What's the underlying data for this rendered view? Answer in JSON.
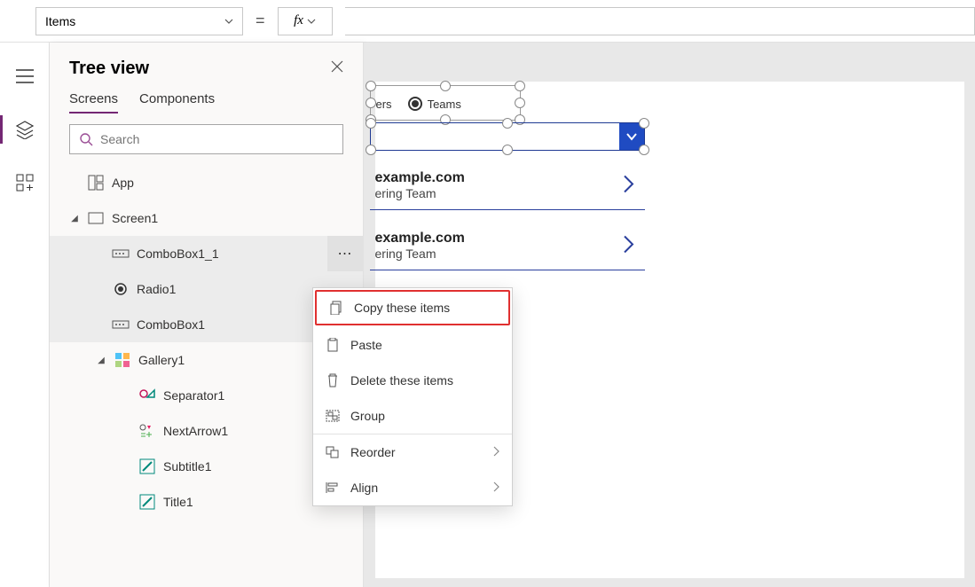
{
  "formula": {
    "property": "Items",
    "equals": "=",
    "fx": "fx"
  },
  "leftrail": {
    "items": [
      "hamburger",
      "layers",
      "grid"
    ]
  },
  "tree": {
    "title": "Tree view",
    "tabs": {
      "screens": "Screens",
      "components": "Components"
    },
    "search_placeholder": "Search",
    "nodes": {
      "app": "App",
      "screen1": "Screen1",
      "combobox1_1": "ComboBox1_1",
      "radio1": "Radio1",
      "combobox1": "ComboBox1",
      "gallery1": "Gallery1",
      "separator1": "Separator1",
      "nextarrow1": "NextArrow1",
      "subtitle1": "Subtitle1",
      "title1": "Title1"
    }
  },
  "canvas": {
    "radio": {
      "opt1": "ers",
      "opt2": "Teams"
    },
    "items": [
      {
        "title": "example.com",
        "sub": "ering Team"
      },
      {
        "title": "example.com",
        "sub": "ering Team"
      }
    ]
  },
  "ctx": {
    "copy": "Copy these items",
    "paste": "Paste",
    "delete": "Delete these items",
    "group": "Group",
    "reorder": "Reorder",
    "align": "Align"
  }
}
